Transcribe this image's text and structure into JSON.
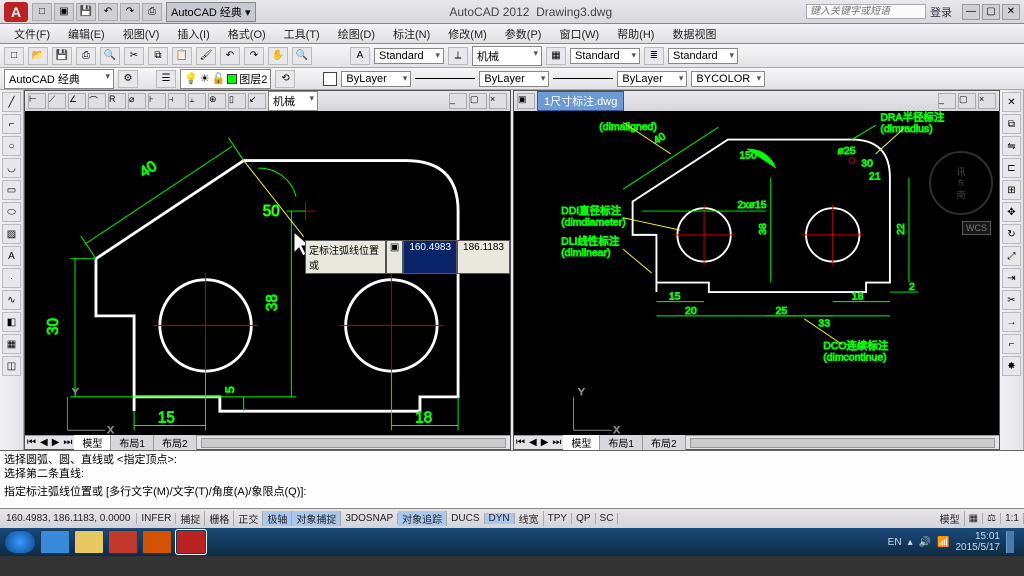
{
  "app": {
    "name": "AutoCAD 2012",
    "file": "Drawing3.dwg"
  },
  "qat_ws": "AutoCAD 经典",
  "search_ph": "键入关键字或短语",
  "login": "登录",
  "menu": [
    "文件(F)",
    "编辑(E)",
    "视图(V)",
    "插入(I)",
    "格式(O)",
    "工具(T)",
    "绘图(D)",
    "标注(N)",
    "修改(M)",
    "参数(P)",
    "窗口(W)",
    "帮助(H)",
    "数据视图"
  ],
  "tb2": {
    "ws": "AutoCAD 经典",
    "layer": "图层2"
  },
  "std": {
    "a": "Standard",
    "b": "机械",
    "c": "Standard",
    "d": "Standard"
  },
  "props": {
    "color": "ByLayer",
    "lt": "ByLayer",
    "lw": "ByLayer",
    "bc": "BYCOLOR"
  },
  "vp1": {
    "mech": "机械",
    "tabs": [
      "模型",
      "布局1",
      "布局2"
    ]
  },
  "vp2": {
    "title": "1尺寸标注.dwg",
    "tabs": [
      "模型",
      "布局1",
      "布局2"
    ]
  },
  "dyninput": {
    "prompt": "定标注弧线位置或",
    "v1": "160.4983",
    "v2": "186.1183"
  },
  "dims": {
    "d40": "40",
    "d30": "30",
    "d15": "15",
    "d18": "18",
    "d38": "38",
    "d50": "50",
    "d5": "5",
    "r150": "150°",
    "r40": "40",
    "p25": "ø25",
    "p30": "30",
    "p21": "21",
    "p22": "22",
    "p2": "2",
    "p2x15": "2xø15",
    "p38": "38",
    "p20": "20",
    "p15a": "15",
    "p25a": "25",
    "p33": "33",
    "p18": "18"
  },
  "labels": {
    "dal": "(dimaligned)",
    "dra": "DRA半径标注",
    "drat": "(dimradius)",
    "ddi": "DDI直径标注",
    "ddit": "(dimdiameter)",
    "dli": "DLI线性标注",
    "dlit": "(dimlinear)",
    "dco": "DCO连续标注",
    "dcot": "(dimcontinue)"
  },
  "cmd": {
    "l1": "选择圆弧、圆、直线或 <指定顶点>:",
    "l2": "选择第二条直线:",
    "l3": "指定标注弧线位置或 [多行文字(M)/文字(T)/角度(A)/象限点(Q)]:"
  },
  "status": {
    "coord": "160.4983, 186.1183, 0.0000",
    "toggles": [
      "INFER",
      "捕捉",
      "栅格",
      "正交",
      "极轴",
      "对象捕捉",
      "3DOSNAP",
      "对象追踪",
      "DUCS",
      "DYN",
      "线宽",
      "TPY",
      "QP",
      "SC"
    ],
    "right": [
      "模型",
      "EN"
    ]
  },
  "clock": {
    "time": "15:01",
    "date": "2015/5/17"
  },
  "watermark": {
    "l1": "讯",
    "l2": "南"
  }
}
